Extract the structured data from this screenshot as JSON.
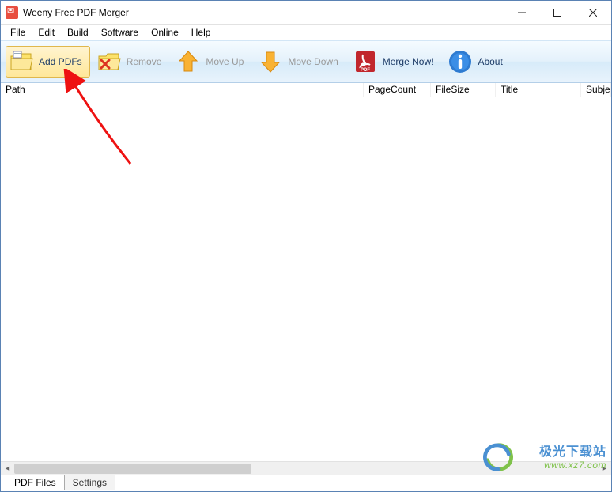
{
  "window": {
    "title": "Weeny Free PDF Merger"
  },
  "menubar": [
    "File",
    "Edit",
    "Build",
    "Software",
    "Online",
    "Help"
  ],
  "toolbar": [
    {
      "id": "add-pdfs",
      "label": "Add PDFs",
      "icon": "folder-add-icon",
      "hovered": true,
      "enabled": true
    },
    {
      "id": "remove",
      "label": "Remove",
      "icon": "folder-delete-icon",
      "hovered": false,
      "enabled": false
    },
    {
      "id": "move-up",
      "label": "Move Up",
      "icon": "arrow-up-icon",
      "hovered": false,
      "enabled": false
    },
    {
      "id": "move-down",
      "label": "Move Down",
      "icon": "arrow-down-icon",
      "hovered": false,
      "enabled": false
    },
    {
      "id": "merge-now",
      "label": "Merge Now!",
      "icon": "pdf-icon",
      "hovered": false,
      "enabled": true
    },
    {
      "id": "about",
      "label": "About",
      "icon": "info-icon",
      "hovered": false,
      "enabled": true
    }
  ],
  "columns": {
    "path": "Path",
    "pagecount": "PageCount",
    "filesize": "FileSize",
    "title": "Title",
    "subject": "Subje"
  },
  "bottom_tabs": {
    "pdf_files": "PDF Files",
    "settings": "Settings",
    "active": "pdf_files"
  },
  "watermark": {
    "line1": "极光下载站",
    "line2": "www.xz7.com"
  }
}
